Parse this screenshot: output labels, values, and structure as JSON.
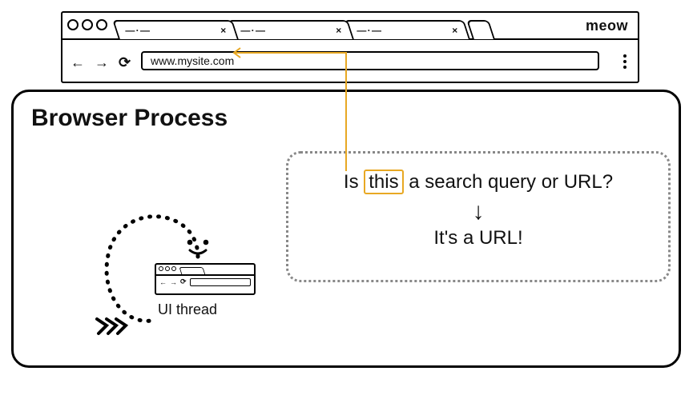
{
  "browser_chrome": {
    "meow_label": "meow",
    "tabs": [
      {
        "label_left": "— · —",
        "close": "×"
      },
      {
        "label_left": "— · —",
        "close": "×"
      },
      {
        "label_left": "— · —",
        "close": "×"
      }
    ],
    "nav": {
      "back": "←",
      "forward": "→",
      "reload": "⟳"
    },
    "address_value": "www.mysite.com"
  },
  "process": {
    "title": "Browser Process",
    "ui_thread": {
      "label": "UI thread",
      "mini_nav": {
        "back": "←",
        "forward": "→",
        "reload": "⟳"
      }
    },
    "thought": {
      "question_prefix": "Is ",
      "question_highlight": "this",
      "question_suffix": " a search query or URL?",
      "arrow": "↓",
      "answer": "It's a URL!"
    },
    "connector_color": "#e8a823"
  }
}
